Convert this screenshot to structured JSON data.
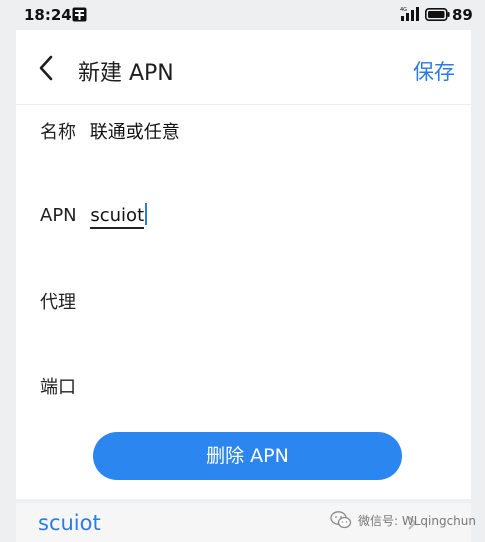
{
  "status_bar": {
    "time": "18:24",
    "notification_icon": "app-notification-icon",
    "signal_icon": "cellular-4g-signal-icon",
    "battery_icon": "battery-icon",
    "battery_level": "89"
  },
  "header": {
    "back_icon": "chevron-left-icon",
    "title": "新建 APN",
    "save_label": "保存"
  },
  "fields": {
    "name": {
      "label": "名称",
      "value": "联通或任意"
    },
    "apn": {
      "label": "APN",
      "value": "scuiot"
    },
    "proxy": {
      "label": "代理",
      "value": ""
    },
    "port": {
      "label": "端口",
      "value": ""
    }
  },
  "delete_button": {
    "label": "删除 APN"
  },
  "list_item": {
    "apn": "scuiot"
  },
  "watermark": {
    "icon": "wechat-icon",
    "text": "微信号: WLqingchun"
  },
  "colors": {
    "accent": "#2c7be5",
    "button": "#2c86f0",
    "background": "#eeeff1"
  }
}
